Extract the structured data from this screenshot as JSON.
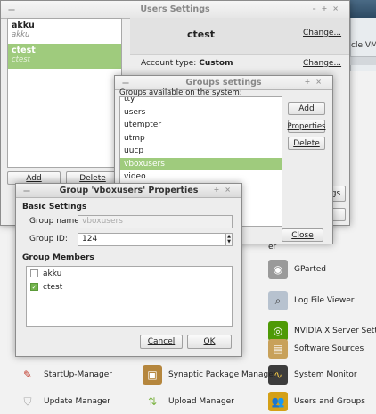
{
  "background": {
    "window_partial_label": "cle VM",
    "launcher_items": [
      {
        "label": "GParted",
        "icon": "harddisk-icon",
        "color": "#8d8d8d"
      },
      {
        "label": "Log File Viewer",
        "icon": "magnifier-log-icon",
        "color": "#9aa7b6"
      },
      {
        "label": "NVIDIA X Server Settings",
        "icon": "nvidia-icon",
        "color": "#4e9a06"
      },
      {
        "label": "Software Sources",
        "icon": "software-sources-icon",
        "color": "#c8a15a"
      },
      {
        "label": "StartUp-Manager",
        "icon": "startup-manager-icon",
        "color": "#c0392b"
      },
      {
        "label": "Synaptic Package Manager",
        "icon": "synaptic-icon",
        "color": "#b5863d"
      },
      {
        "label": "System Monitor",
        "icon": "system-monitor-icon",
        "color": "#3c3c3c"
      },
      {
        "label": "Update Manager",
        "icon": "shield-icon",
        "color": "#c5c5c5"
      },
      {
        "label": "Upload Manager",
        "icon": "upload-arrows-icon",
        "color": "#7cb342"
      },
      {
        "label": "Users and Groups",
        "icon": "users-icon",
        "color": "#d4a017"
      }
    ],
    "partial_label_er": "er"
  },
  "users_window": {
    "title": "Users Settings",
    "users": [
      {
        "name": "akku",
        "full_name": "akku",
        "selected": false
      },
      {
        "name": "ctest",
        "full_name": "ctest",
        "selected": true
      }
    ],
    "add_label": "Add",
    "delete_label": "Delete",
    "selected_user": "ctest",
    "change_label_1": "Change...",
    "account_type_label": "Account type:",
    "account_type_value": "Custom",
    "change_label_2": "Change...",
    "groups_button_partial": "gs"
  },
  "groups_dialog": {
    "title": "Groups settings",
    "heading": "Groups available on the system:",
    "groups": [
      "tty",
      "users",
      "utempter",
      "utmp",
      "uucp",
      "vboxusers",
      "video"
    ],
    "selected_group": "vboxusers",
    "add_label": "Add",
    "properties_label": "Properties",
    "delete_label": "Delete",
    "close_label": "Close"
  },
  "properties_dialog": {
    "title": "Group 'vboxusers' Properties",
    "basic_settings_label": "Basic Settings",
    "group_name_label": "Group name:",
    "group_name_value": "vboxusers",
    "group_id_label": "Group ID:",
    "group_id_value": "124",
    "members_label": "Group Members",
    "members": [
      {
        "name": "akku",
        "checked": false
      },
      {
        "name": "ctest",
        "checked": true
      }
    ],
    "cancel_label": "Cancel",
    "ok_label": "OK"
  },
  "colors": {
    "selection_green": "#9fcb7d",
    "check_green": "#72b34c"
  }
}
